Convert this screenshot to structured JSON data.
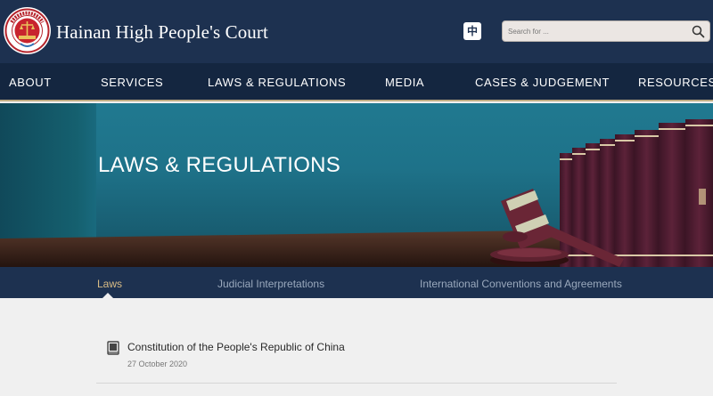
{
  "header": {
    "court_name": "Hainan High People's Court",
    "language_toggle": "中",
    "search_placeholder": "Search for ...",
    "emblem_icon": "court-emblem-icon"
  },
  "nav": {
    "items": [
      "ABOUT",
      "SERVICES",
      "LAWS & REGULATIONS",
      "MEDIA",
      "CASES & JUDGEMENT",
      "RESOURCES"
    ]
  },
  "hero": {
    "title": "LAWS & REGULATIONS"
  },
  "subnav": {
    "items": [
      "Laws",
      "Judicial Interpretations",
      "International Conventions and Agreements"
    ],
    "active": "Laws"
  },
  "entries": [
    {
      "icon": "book-icon",
      "title": "Constitution of the People's Republic of China",
      "date": "27 October 2020"
    }
  ],
  "colors": {
    "header_bg": "#1d3150",
    "nav_bg": "#142640",
    "accent_gold": "#c0ad84",
    "active_tab": "#d8bb85",
    "hero_teal": "#1e7289",
    "page_bg": "#f0f0f0"
  }
}
